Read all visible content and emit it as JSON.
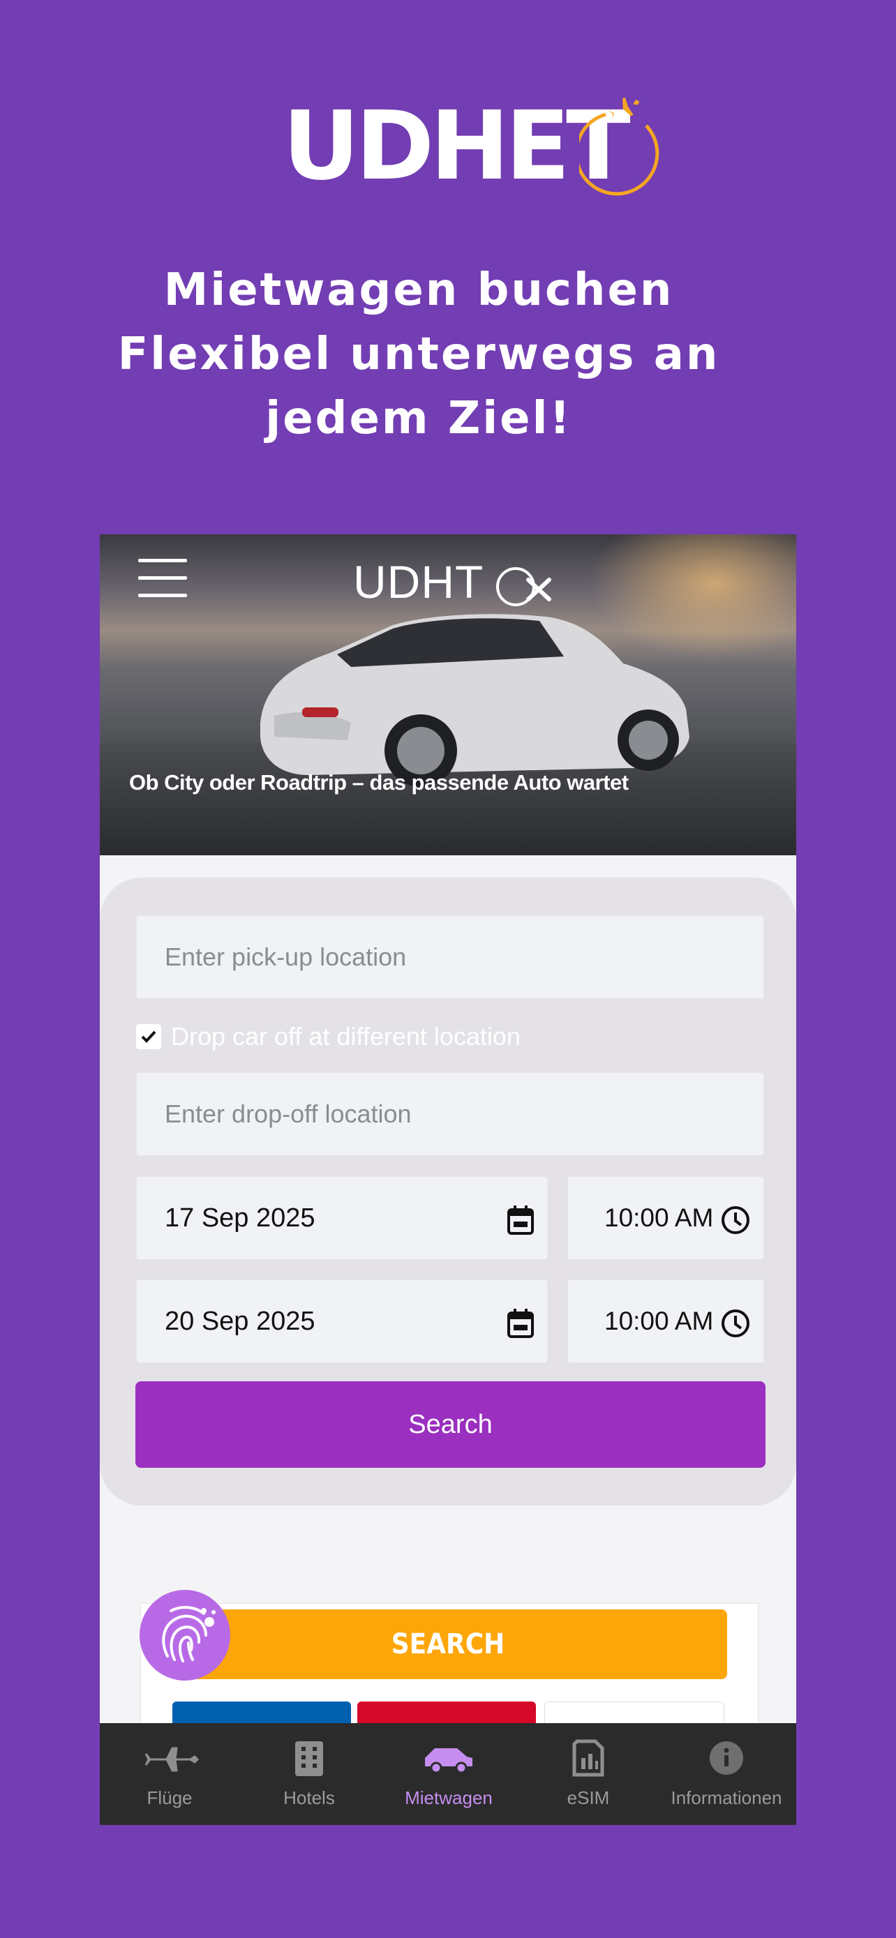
{
  "brand": {
    "logo_text": "UDHET",
    "accent": "#f5a623",
    "background": "#733db3"
  },
  "tagline": [
    "Mietwagen buchen",
    "Flexibel unterwegs an",
    "jedem Ziel!"
  ],
  "app": {
    "hero": {
      "logo_text": "UDHT",
      "caption": "Ob City oder Roadtrip – das passende Auto wartet"
    },
    "form": {
      "pickup_placeholder": "Enter pick-up location",
      "dropoff_checkbox_label": "Drop car off at different location",
      "dropoff_checked": true,
      "dropoff_placeholder": "Enter drop-off location",
      "pickup_date": "17 Sep 2025",
      "pickup_time": "10:00 AM",
      "return_date": "20 Sep 2025",
      "return_time": "10:00 AM",
      "search_label": "Search",
      "button_color": "#9b2fbf"
    },
    "widget": {
      "search_label": "SEARCH"
    },
    "bottom_nav": [
      {
        "label": "Flüge",
        "icon": "plane-icon"
      },
      {
        "label": "Hotels",
        "icon": "building-icon"
      },
      {
        "label": "Mietwagen",
        "icon": "car-icon",
        "active": true
      },
      {
        "label": "eSIM",
        "icon": "sim-card-icon"
      },
      {
        "label": "Informationen",
        "icon": "info-icon"
      }
    ]
  }
}
